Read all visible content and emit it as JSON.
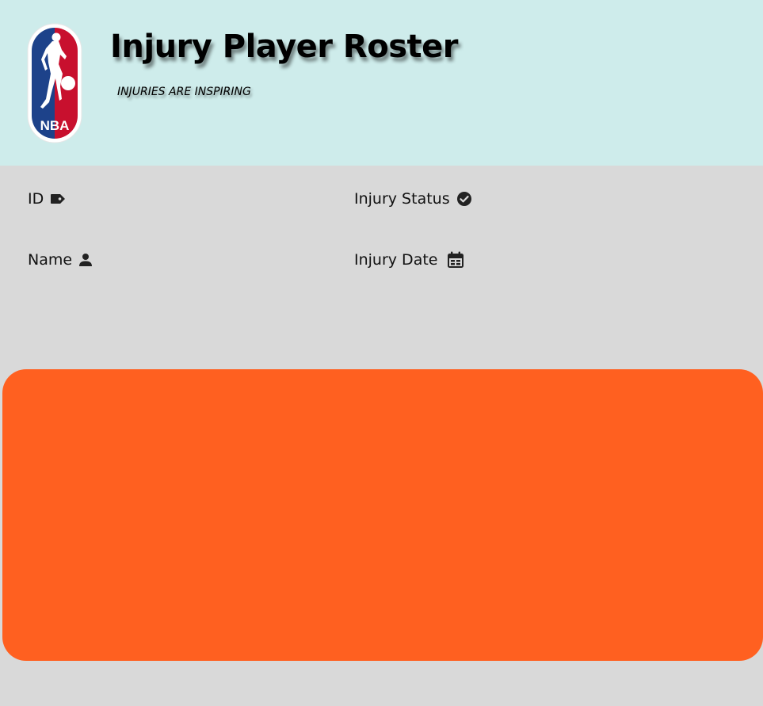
{
  "header": {
    "title": "Injury Player Roster",
    "subtitle": "INJURIES ARE INSPIRING",
    "logo_icon": "nba-logo",
    "logo_text": "NBA",
    "background_color": "#ceeceb"
  },
  "fields": {
    "id_label": "ID",
    "id_icon": "tag-icon",
    "status_label": "Injury Status",
    "status_icon": "check-circle-icon",
    "name_label": "Name",
    "name_icon": "person-icon",
    "date_label": "Injury Date",
    "date_icon": "calendar-icon"
  },
  "panel": {
    "color": "#ff6020"
  },
  "page": {
    "background_color": "#d9d9d9"
  }
}
